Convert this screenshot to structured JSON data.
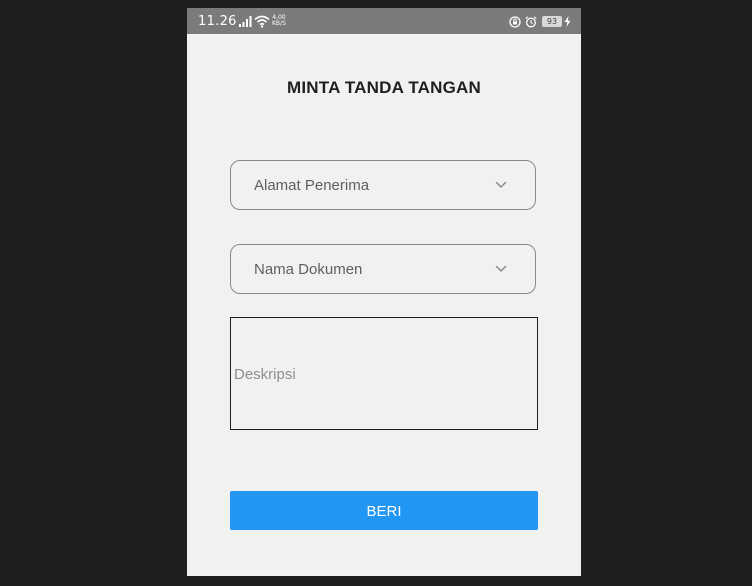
{
  "status_bar": {
    "time": "11.26",
    "net_speed_value": "4,00",
    "net_speed_unit": "KB/S",
    "battery": "93",
    "icons": [
      "signal-icon",
      "wifi-icon",
      "rotation-lock-icon",
      "alarm-icon",
      "charging-icon"
    ]
  },
  "page": {
    "title": "MINTA TANDA TANGAN"
  },
  "form": {
    "recipient": {
      "label": "Alamat Penerima",
      "icon": "chevron-down-icon"
    },
    "document": {
      "label": "Nama Dokumen",
      "icon": "chevron-down-icon"
    },
    "description": {
      "placeholder": "Deskripsi",
      "value": ""
    },
    "submit_label": "BERI"
  },
  "colors": {
    "background": "#1f1f1f",
    "screen": "#f1f2ef",
    "status_bar": "#7b7b7b",
    "accent": "#2196f3"
  }
}
